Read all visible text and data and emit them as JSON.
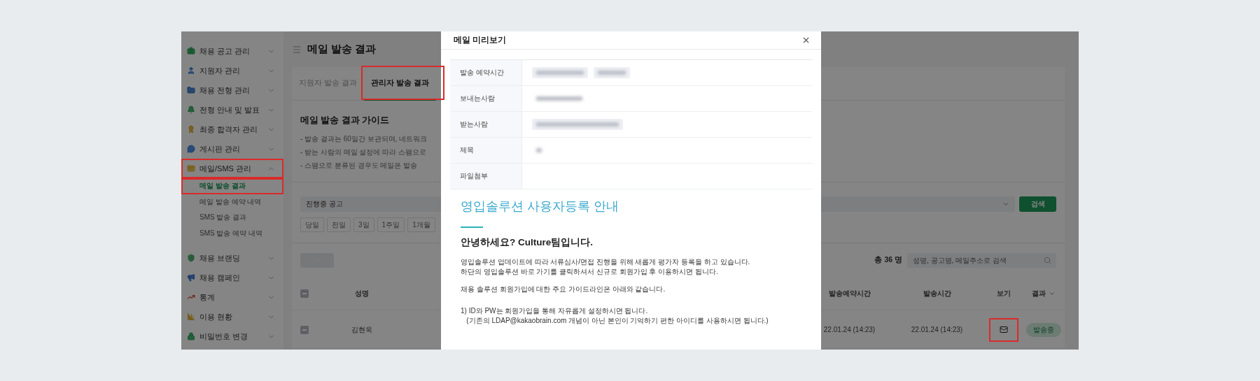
{
  "sidebar": {
    "items": [
      {
        "label": "채용 공고 관리",
        "expanded": false,
        "highlighted": false
      },
      {
        "label": "지원자 관리",
        "expanded": false,
        "highlighted": false
      },
      {
        "label": "채용 전형 관리",
        "expanded": false,
        "highlighted": false
      },
      {
        "label": "전형 안내 및 발표",
        "expanded": false,
        "highlighted": false
      },
      {
        "label": "최종 합격자 관리",
        "expanded": false,
        "highlighted": false
      },
      {
        "label": "게시판 관리",
        "expanded": false,
        "highlighted": false
      },
      {
        "label": "메일/SMS 관리",
        "expanded": true,
        "highlighted": true,
        "children": [
          {
            "label": "메일 발송 결과",
            "selected": true,
            "highlighted": true
          },
          {
            "label": "메일 발송 예약 내역",
            "selected": false,
            "highlighted": false
          },
          {
            "label": "SMS 발송 결과",
            "selected": false,
            "highlighted": false
          },
          {
            "label": "SMS 발송 예약 내역",
            "selected": false,
            "highlighted": false
          }
        ]
      },
      {
        "label": "채용 브랜딩",
        "expanded": false,
        "highlighted": false
      },
      {
        "label": "채용 캠페인",
        "expanded": false,
        "highlighted": false
      },
      {
        "label": "통계",
        "expanded": false,
        "highlighted": false
      },
      {
        "label": "이용 현황",
        "expanded": false,
        "highlighted": false
      },
      {
        "label": "비밀번호 변경",
        "expanded": false,
        "highlighted": false
      }
    ]
  },
  "page": {
    "title": "메일 발송 결과"
  },
  "tabs": [
    {
      "label": "지원자 발송 결과",
      "selected": false,
      "highlighted": false
    },
    {
      "label": "관리자 발송 결과",
      "selected": true,
      "highlighted": true
    }
  ],
  "guide": {
    "title": "메일 발송 결과 가이드",
    "bullets": [
      "- 발송 결과는 60일간 보관되며, 네트워크",
      "- 받는 사람의 메일 설정에 따라 스팸으로",
      "- 스팸으로 분류된 경우도 메일은 발송"
    ]
  },
  "filter": {
    "select_value": "진행중 공고",
    "search_button": "검색",
    "date_buttons": [
      "당일",
      "전일",
      "3일",
      "1주일",
      "1개월"
    ]
  },
  "results": {
    "header_checked": false,
    "total": "총 36 명",
    "search_placeholder": "성명, 공고명, 메일주소로 검색",
    "columns": [
      "성명",
      "발송예약시간",
      "발송시간",
      "보기",
      "결과"
    ],
    "rows": [
      {
        "checked": false,
        "name": "김현욱",
        "reserved_at": "22.01.24 (14:23)",
        "sent_at": "22.01.24 (14:23)",
        "view_highlighted": true,
        "status": "발송중"
      }
    ]
  },
  "modal": {
    "title": "메일 미리보기",
    "fields": [
      {
        "label": "발송 예약시간",
        "redacted": true
      },
      {
        "label": "보내는사람",
        "redacted": true
      },
      {
        "label": "받는사람",
        "redacted": true
      },
      {
        "label": "제목",
        "redacted": true
      },
      {
        "label": "파일첨부",
        "redacted": false
      }
    ],
    "mail": {
      "heading": "영입솔루션 사용자등록 안내",
      "greeting": "안녕하세요? Culture팀입니다.",
      "paragraphs": [
        "영입솔루션 업데이트에 따라 서류심사/면접 진행을 위해 새롭게 평가자 등록을 하고 있습니다.\n하단의 영입솔루션 바로 가기를 클릭하셔서 신규로 회원가입 후 이용하시면 됩니다.",
        "채용 솔루션 회원가입에 대한 주요 가이드라인은 아래와 같습니다.",
        "1) ID와 PW는 회원가입을 통해 자유롭게 설정하시면 됩니다.\n   (기존의 LDAP@kakaobrain.com 개념이 아닌 본인이 기억하기 편한 아이디를 사용하시면 됩니다.)"
      ]
    }
  }
}
